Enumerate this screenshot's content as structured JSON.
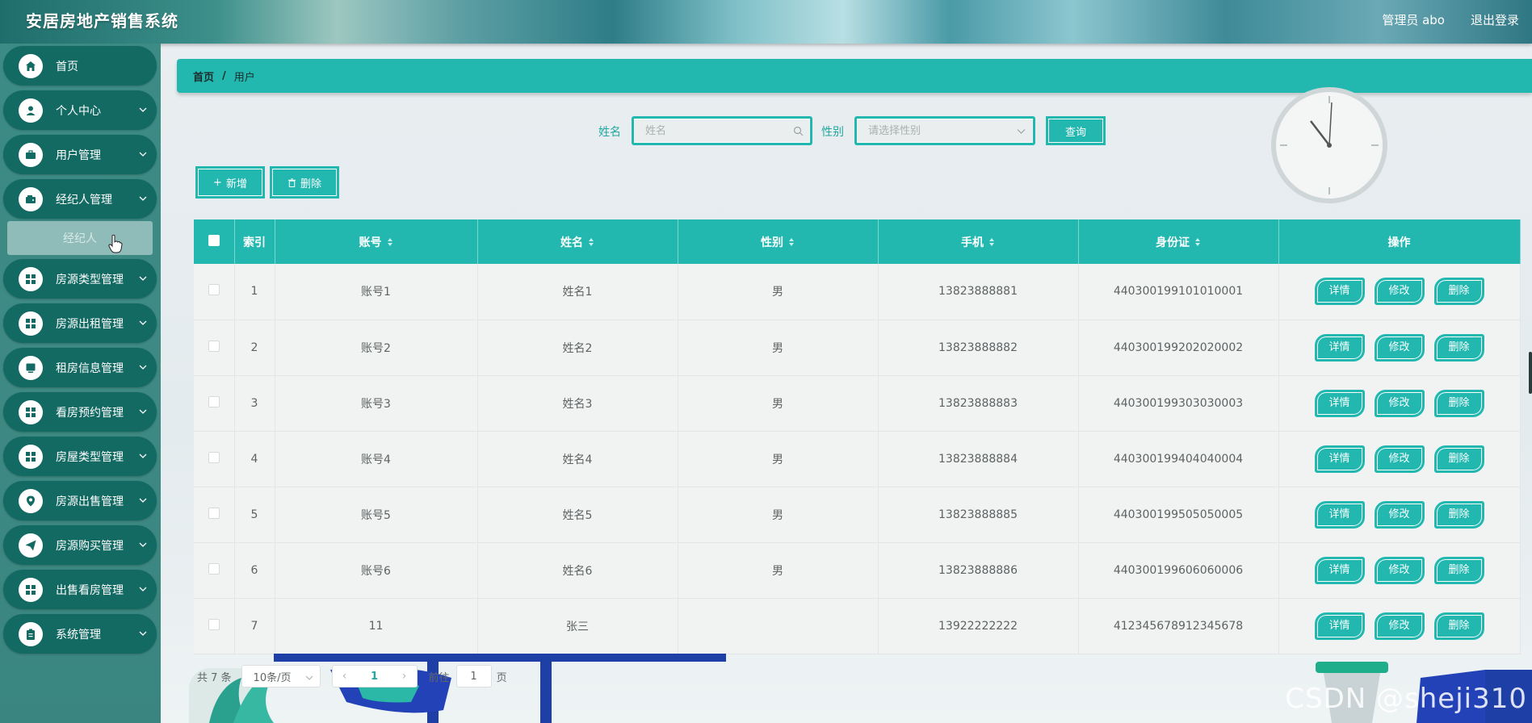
{
  "header": {
    "title": "安居房地产销售系统",
    "user": "管理员 abo",
    "logout": "退出登录"
  },
  "sidebar": {
    "items": [
      {
        "label": "首页",
        "icon": "home-icon"
      },
      {
        "label": "个人中心",
        "icon": "user-icon"
      },
      {
        "label": "用户管理",
        "icon": "briefcase-icon"
      },
      {
        "label": "经纪人管理",
        "icon": "wallet-icon"
      },
      {
        "label": "房源类型管理",
        "icon": "grid-icon"
      },
      {
        "label": "房源出租管理",
        "icon": "grid-icon"
      },
      {
        "label": "租房信息管理",
        "icon": "monitor-icon"
      },
      {
        "label": "看房预约管理",
        "icon": "grid-icon"
      },
      {
        "label": "房屋类型管理",
        "icon": "grid-icon"
      },
      {
        "label": "房源出售管理",
        "icon": "location-icon"
      },
      {
        "label": "房源购买管理",
        "icon": "send-icon"
      },
      {
        "label": "出售看房管理",
        "icon": "grid-icon"
      },
      {
        "label": "系统管理",
        "icon": "clipboard-icon"
      }
    ],
    "submenu": {
      "label": "经纪人"
    }
  },
  "breadcrumb": {
    "home": "首页",
    "separator": "/",
    "current": "用户"
  },
  "search": {
    "name_label": "姓名",
    "name_placeholder": "姓名",
    "gender_label": "性别",
    "gender_placeholder": "请选择性别",
    "query_button": "查询"
  },
  "actions": {
    "add": "新增",
    "delete": "删除"
  },
  "table": {
    "columns": [
      "",
      "索引",
      "账号",
      "姓名",
      "性别",
      "手机",
      "身份证",
      "操作"
    ],
    "rows": [
      [
        "1",
        "账号1",
        "姓名1",
        "男",
        "13823888881",
        "440300199101010001"
      ],
      [
        "2",
        "账号2",
        "姓名2",
        "男",
        "13823888882",
        "440300199202020002"
      ],
      [
        "3",
        "账号3",
        "姓名3",
        "男",
        "13823888883",
        "440300199303030003"
      ],
      [
        "4",
        "账号4",
        "姓名4",
        "男",
        "13823888884",
        "440300199404040004"
      ],
      [
        "5",
        "账号5",
        "姓名5",
        "男",
        "13823888885",
        "440300199505050005"
      ],
      [
        "6",
        "账号6",
        "姓名6",
        "男",
        "13823888886",
        "440300199606060006"
      ],
      [
        "7",
        "11",
        "张三",
        "",
        "13922222222",
        "412345678912345678"
      ]
    ],
    "row_actions": {
      "detail": "详情",
      "edit": "修改",
      "delete": "删除"
    }
  },
  "pagination": {
    "total": "共 7 条",
    "page_size": "10条/页",
    "current_page": "1",
    "goto_label": "前往",
    "goto_value": "1",
    "page_suffix": "页"
  },
  "watermark": "CSDN @sheji310",
  "colors": {
    "primary": "#22b8b0",
    "menu": "#136a63",
    "sidebar": "#3c8b85"
  }
}
